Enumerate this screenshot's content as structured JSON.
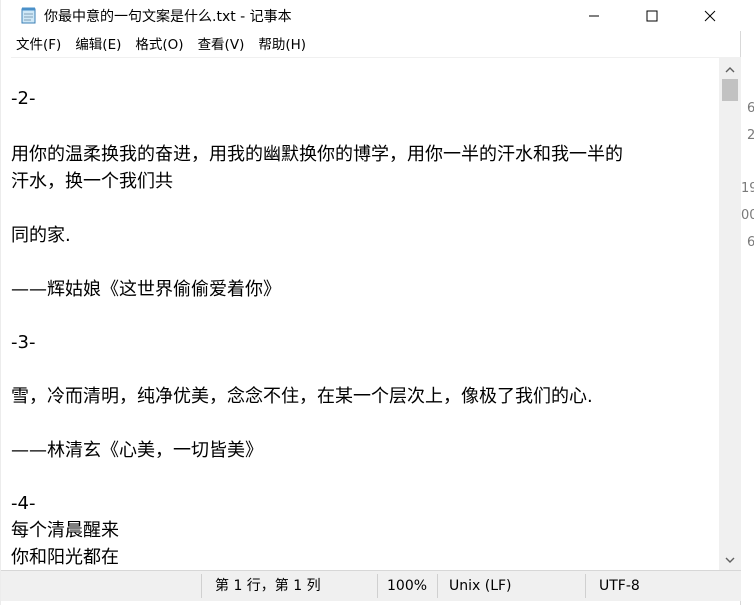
{
  "window": {
    "title": "你最中意的一句文案是什么.txt - 记事本"
  },
  "menu": [
    {
      "label": "文件(F)"
    },
    {
      "label": "编辑(E)"
    },
    {
      "label": "格式(O)"
    },
    {
      "label": "查看(V)"
    },
    {
      "label": "帮助(H)"
    }
  ],
  "editor": {
    "lines": [
      " -2-",
      " 用你的温柔换我的奋进，用我的幽默换你的博学，用你一半的汗水和我一半的",
      "汗水，换一个我们共",
      " 同的家.",
      " ——辉姑娘《这世界偷偷爱着你》",
      " -3-",
      " 雪，冷而清明，纯净优美，念念不住，在某一个层次上，像极了我们的心.",
      " ——林清玄《心美，一切皆美》",
      " -4-",
      " 每个清晨醒来",
      " 你和阳光都在"
    ]
  },
  "status": {
    "position": "第 1 行，第 1 列",
    "zoom": "100%",
    "line_ending": "Unix (LF)",
    "encoding": "UTF-8"
  },
  "background_window": {
    "fragments": [
      "6",
      "2",
      "19",
      "00",
      "6"
    ]
  },
  "icons": {
    "app": "notepad-icon",
    "minimize": "minimize-icon",
    "maximize": "maximize-icon",
    "close": "close-icon",
    "scroll_up": "chevron-up-icon",
    "scroll_down": "chevron-down-icon"
  }
}
